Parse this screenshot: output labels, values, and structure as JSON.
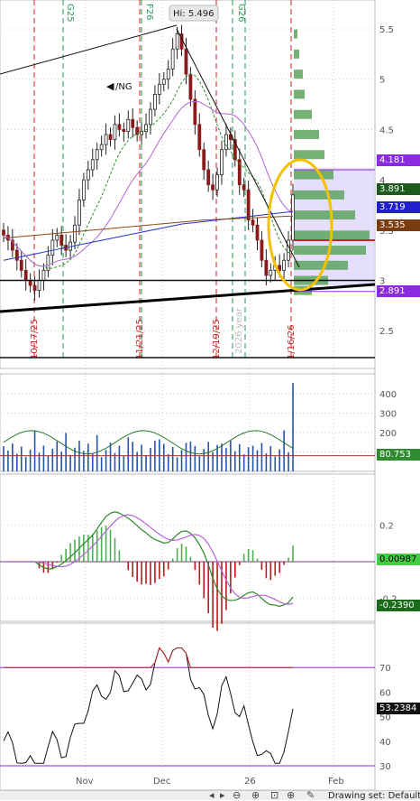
{
  "symbol": "/NG",
  "high_label": "Hi: 5.496",
  "drawing_set_label": "Drawing set: Default",
  "colors": {
    "up_candle": "#ffffff",
    "down_candle": "#8b1a1a",
    "volume_profile": "#5ea35e",
    "value_area": "#ded6fb",
    "ellipse": "#f2c200",
    "grid": "#cccccc",
    "event_red": "#cc2222",
    "event_green": "#229955"
  },
  "chart_data": [
    {
      "type": "candlestick",
      "panel": "price",
      "y_ticks": [
        "5.5",
        "5",
        "4.5",
        "4",
        "3.5",
        "3",
        "2.5"
      ],
      "ylim": [
        2.2,
        5.7
      ],
      "x_labels": [
        "Nov",
        "Dec",
        "26",
        "Feb"
      ],
      "event_dates": [
        "10/17/25",
        "11/21/25",
        "12/19/25",
        "1/16/26"
      ],
      "event_top_labels": [
        "G25",
        "F26",
        "G26"
      ],
      "year_marker": "2026 year",
      "price_tags": [
        {
          "value": "4.181",
          "color": "#8a2be2",
          "text": "#ffffff"
        },
        {
          "value": "3.891",
          "color": "#1e5a1e",
          "text": "#ffffff"
        },
        {
          "value": "3.719",
          "color": "#1f1fcc",
          "text": "#ffffff"
        },
        {
          "value": "3.535",
          "color": "#7a3c10",
          "text": "#ffffff"
        },
        {
          "value": "2.891",
          "color": "#8a2be2",
          "text": "#ffffff"
        }
      ],
      "closes": [
        3.45,
        3.4,
        3.3,
        3.2,
        3.1,
        3.0,
        2.95,
        2.9,
        3.0,
        3.1,
        3.25,
        3.4,
        3.45,
        3.35,
        3.3,
        3.38,
        3.55,
        3.8,
        4.0,
        4.1,
        4.2,
        4.3,
        4.35,
        4.45,
        4.4,
        4.55,
        4.5,
        4.48,
        4.6,
        4.52,
        4.45,
        4.48,
        4.55,
        4.7,
        4.85,
        4.95,
        5.0,
        5.1,
        5.3,
        5.45,
        5.3,
        5.05,
        4.8,
        4.55,
        4.3,
        4.1,
        3.95,
        3.9,
        4.05,
        4.3,
        4.45,
        4.4,
        4.2,
        3.95,
        3.9,
        3.6,
        3.55,
        3.4,
        3.2,
        3.05,
        3.1,
        3.15,
        3.1,
        3.2,
        3.4,
        3.85
      ]
    },
    {
      "type": "bar",
      "panel": "volume",
      "y_ticks": [
        "400",
        "300",
        "200",
        "100"
      ],
      "current_value": "80.753"
    },
    {
      "type": "line",
      "panel": "macd",
      "y_ticks": [
        "0.2",
        "-0.2"
      ],
      "values": [
        "0.00987",
        "-0.2390"
      ]
    },
    {
      "type": "line",
      "panel": "rsi",
      "y_ticks": [
        "70",
        "60",
        "50",
        "40",
        "30"
      ],
      "current_value": "53.2384"
    }
  ]
}
